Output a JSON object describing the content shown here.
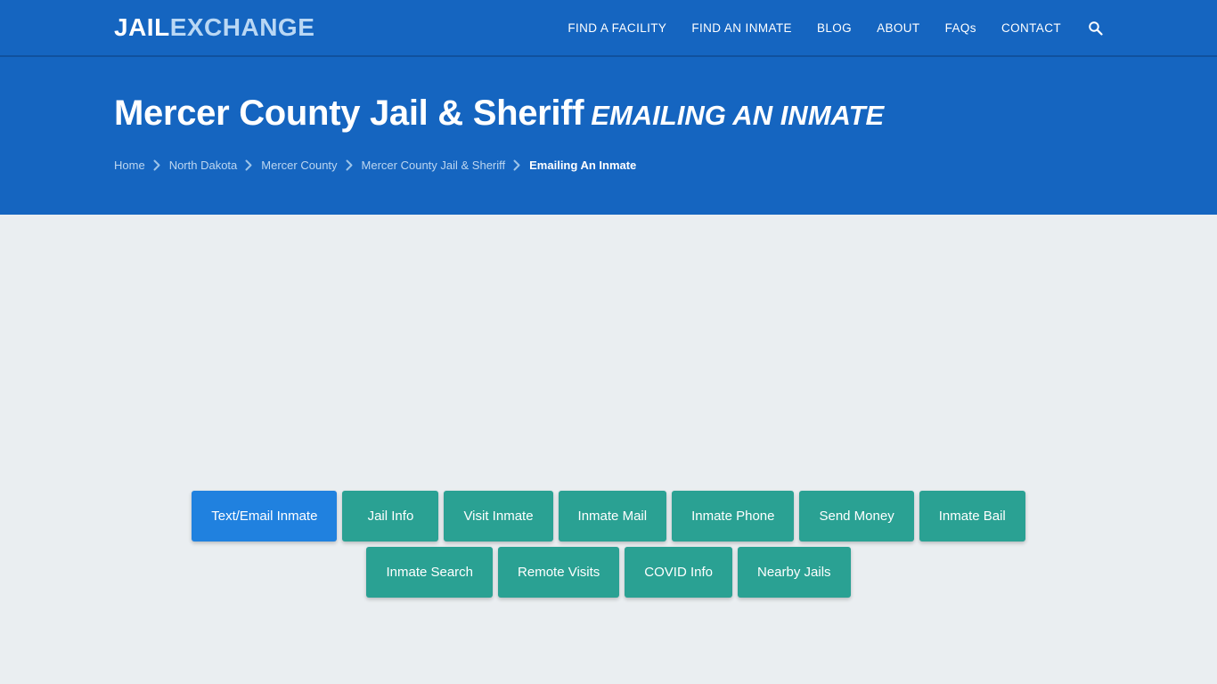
{
  "header": {
    "logo": {
      "primary": "JAIL",
      "secondary": "EXCHANGE"
    },
    "nav_items": [
      {
        "label": "FIND A FACILITY",
        "name": "nav-find-a-facility"
      },
      {
        "label": "FIND AN INMATE",
        "name": "nav-find-an-inmate"
      },
      {
        "label": "BLOG",
        "name": "nav-blog"
      },
      {
        "label": "ABOUT",
        "name": "nav-about"
      },
      {
        "label": "FAQs",
        "name": "nav-faqs"
      },
      {
        "label": "CONTACT",
        "name": "nav-contact"
      }
    ],
    "search_icon": "search-icon"
  },
  "hero": {
    "title_main": "Mercer County Jail & Sheriff",
    "title_sub": "EMAILING AN INMATE",
    "breadcrumb": [
      {
        "label": "Home",
        "current": false
      },
      {
        "label": "North Dakota",
        "current": false
      },
      {
        "label": "Mercer County",
        "current": false
      },
      {
        "label": "Mercer County Jail & Sheriff",
        "current": false
      },
      {
        "label": "Emailing An Inmate",
        "current": true
      }
    ],
    "breadcrumb_separator": "chevron-right-icon"
  },
  "facility_nav": {
    "row1": [
      {
        "label": "Text/Email Inmate",
        "active": true
      },
      {
        "label": "Jail Info",
        "active": false
      },
      {
        "label": "Visit Inmate",
        "active": false
      },
      {
        "label": "Inmate Mail",
        "active": false
      },
      {
        "label": "Inmate Phone",
        "active": false
      },
      {
        "label": "Send Money",
        "active": false
      },
      {
        "label": "Inmate Bail",
        "active": false
      }
    ],
    "row2": [
      {
        "label": "Inmate Search",
        "active": false
      },
      {
        "label": "Remote Visits",
        "active": false
      },
      {
        "label": "COVID Info",
        "active": false
      },
      {
        "label": "Nearby Jails",
        "active": false
      }
    ]
  },
  "colors": {
    "header_blue": "#1565c0",
    "active_button_blue": "#2081df",
    "button_teal": "#2aa193",
    "page_background": "#eaeef1",
    "logo_secondary": "#b9d7f4"
  }
}
